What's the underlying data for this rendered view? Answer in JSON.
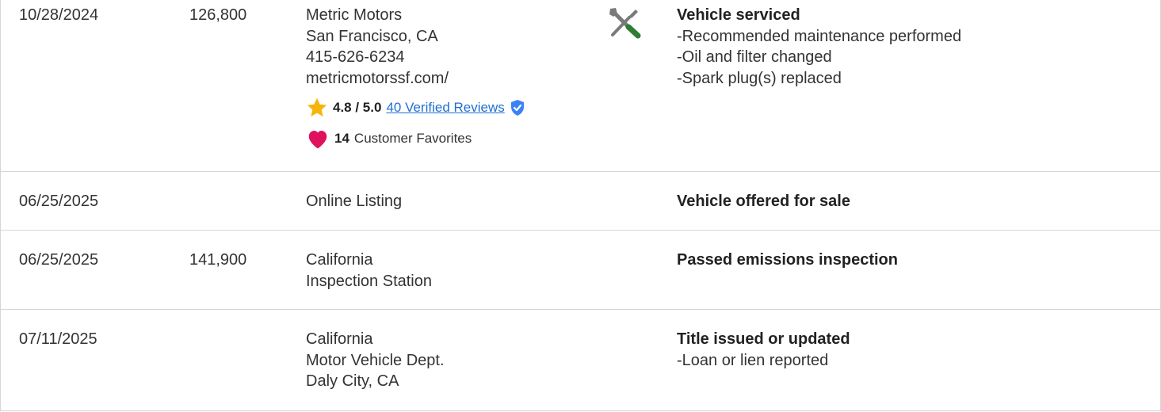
{
  "rows": [
    {
      "date": "10/28/2024",
      "mileage": "126,800",
      "source_lines": [
        "Metric Motors",
        "San Francisco, CA",
        "415-626-6234",
        "metricmotorssf.com/"
      ],
      "rating": {
        "score": "4.8 / 5.0",
        "reviews_label": "40 Verified Reviews"
      },
      "favorites": {
        "count": "14",
        "label": "Customer Favorites"
      },
      "icon": "service-tools-icon",
      "detail_title": "Vehicle serviced",
      "detail_items": [
        "Recommended maintenance performed",
        "Oil and filter changed",
        "Spark plug(s) replaced"
      ]
    },
    {
      "date": "06/25/2025",
      "mileage": "",
      "source_lines": [
        "Online Listing"
      ],
      "detail_title": "Vehicle offered for sale",
      "detail_items": []
    },
    {
      "date": "06/25/2025",
      "mileage": "141,900",
      "source_lines": [
        "California",
        "Inspection Station"
      ],
      "detail_title": "Passed emissions inspection",
      "detail_items": []
    },
    {
      "date": "07/11/2025",
      "mileage": "",
      "source_lines": [
        "California",
        "Motor Vehicle Dept.",
        "Daly City, CA"
      ],
      "detail_title": "Title issued or updated",
      "detail_items": [
        "Loan or lien reported"
      ]
    }
  ],
  "bullet": "-",
  "colors": {
    "star": "#f5b50a",
    "heart": "#e0115f",
    "verified": "#3b82f6",
    "link": "#1f6fd1",
    "wrench_handle": "#2e7d32",
    "tool_gray": "#7a7a7a"
  }
}
